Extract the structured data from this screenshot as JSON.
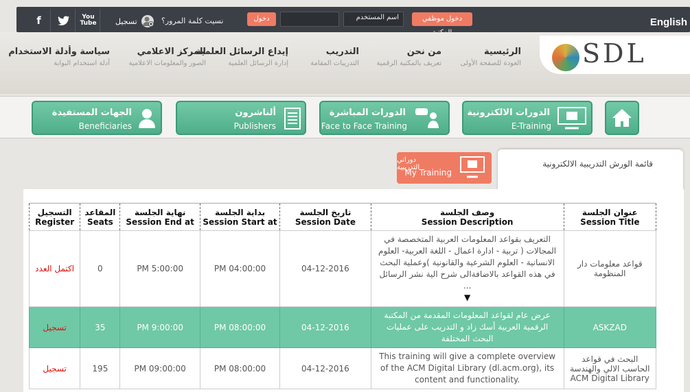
{
  "topbar": {
    "english": "English",
    "register": "تسجيل",
    "forgot": "نسيت كلمة المرور؟",
    "login": "دخول",
    "username_placeholder": "اسم المستخدم",
    "staff_login": "دخول موظفي المكتبة"
  },
  "social": [
    "f",
    "🐦",
    "You Tube"
  ],
  "logo": "SDL",
  "nav": [
    {
      "title": "الرئيسية",
      "sub": "العودة للصفحة الأولى"
    },
    {
      "title": "من نحن",
      "sub": "تعريف بالمكتبة الرقمية"
    },
    {
      "title": "التدريب",
      "sub": "التدريبات المقامة"
    },
    {
      "title": "إيداع الرسائل العلمية",
      "sub": "إدارة الرسائل العلمية"
    },
    {
      "title": "المركز الاعلامي",
      "sub": "الصور والمعلومات الاعلامية"
    },
    {
      "title": "سياسة وأدلة الاستخدام",
      "sub": "أدلة استخدام البوابة"
    }
  ],
  "menu": [
    {
      "ar": "الدورات الالكترونية",
      "en": "E-Training"
    },
    {
      "ar": "الدورات المباشرة",
      "en": "Face to Face Training"
    },
    {
      "ar": "ألناشرون",
      "en": "Publishers"
    },
    {
      "ar": "الجهات المستفيدة",
      "en": "Beneficiaries"
    }
  ],
  "tab_title": "قائمة الورش التدريبية الالكترونية",
  "mytraining": {
    "ar": "دوراتي التدريبية",
    "en": "My Training"
  },
  "table": {
    "headers": [
      {
        "ar": "عنوان الجلسة",
        "en": "Session Title"
      },
      {
        "ar": "وصف الجلسة",
        "en": "Session Description"
      },
      {
        "ar": "تاريخ الجلسة",
        "en": "Session Date"
      },
      {
        "ar": "بداية الجلسة",
        "en": "Session Start at"
      },
      {
        "ar": "نهاية الجلسة",
        "en": "Session End at"
      },
      {
        "ar": "المقاعد",
        "en": "Seats"
      },
      {
        "ar": "التسجيل",
        "en": "Register"
      }
    ],
    "rows": [
      {
        "title": "قواعد معلومات دار المنظومة",
        "desc": "التعريف بقواعد المعلومات العربية المتخصصة في المجالات ( تربية - ادارة اعمال - اللغة العربية- العلوم الانسانية - العلوم الشرعية والقانونية )وعملية البحث في هذه القواعد بالاضافةالى شرح الية نشر الرسائل ...",
        "more": "▼",
        "date": "04-12-2016",
        "start": "04:00:00 PM",
        "end": "5:00:00 PM",
        "seats": "0",
        "register": "اكتمل العدد"
      },
      {
        "title": "ASKZAD",
        "desc": "عرض عام لقواعد المعلومات المقدمة من المكتبة الرقمية العربية أسك زاد و التدريب على عمليات البحث المختلفة",
        "date": "04-12-2016",
        "start": "08:00:00 PM",
        "end": "9:00:00 PM",
        "seats": "35",
        "register": "تسجيل"
      },
      {
        "title": "البحث في قواعد الحاسب الالي والهندسة ACM Digital Library",
        "desc": "This training will give a complete overview of the ACM Digital Library (dl.acm.org), its content and functionality.",
        "date": "04-12-2016",
        "start": "08:00:00 PM",
        "end": "09:00:00 PM",
        "seats": "195",
        "register": "تسجيل"
      }
    ]
  }
}
